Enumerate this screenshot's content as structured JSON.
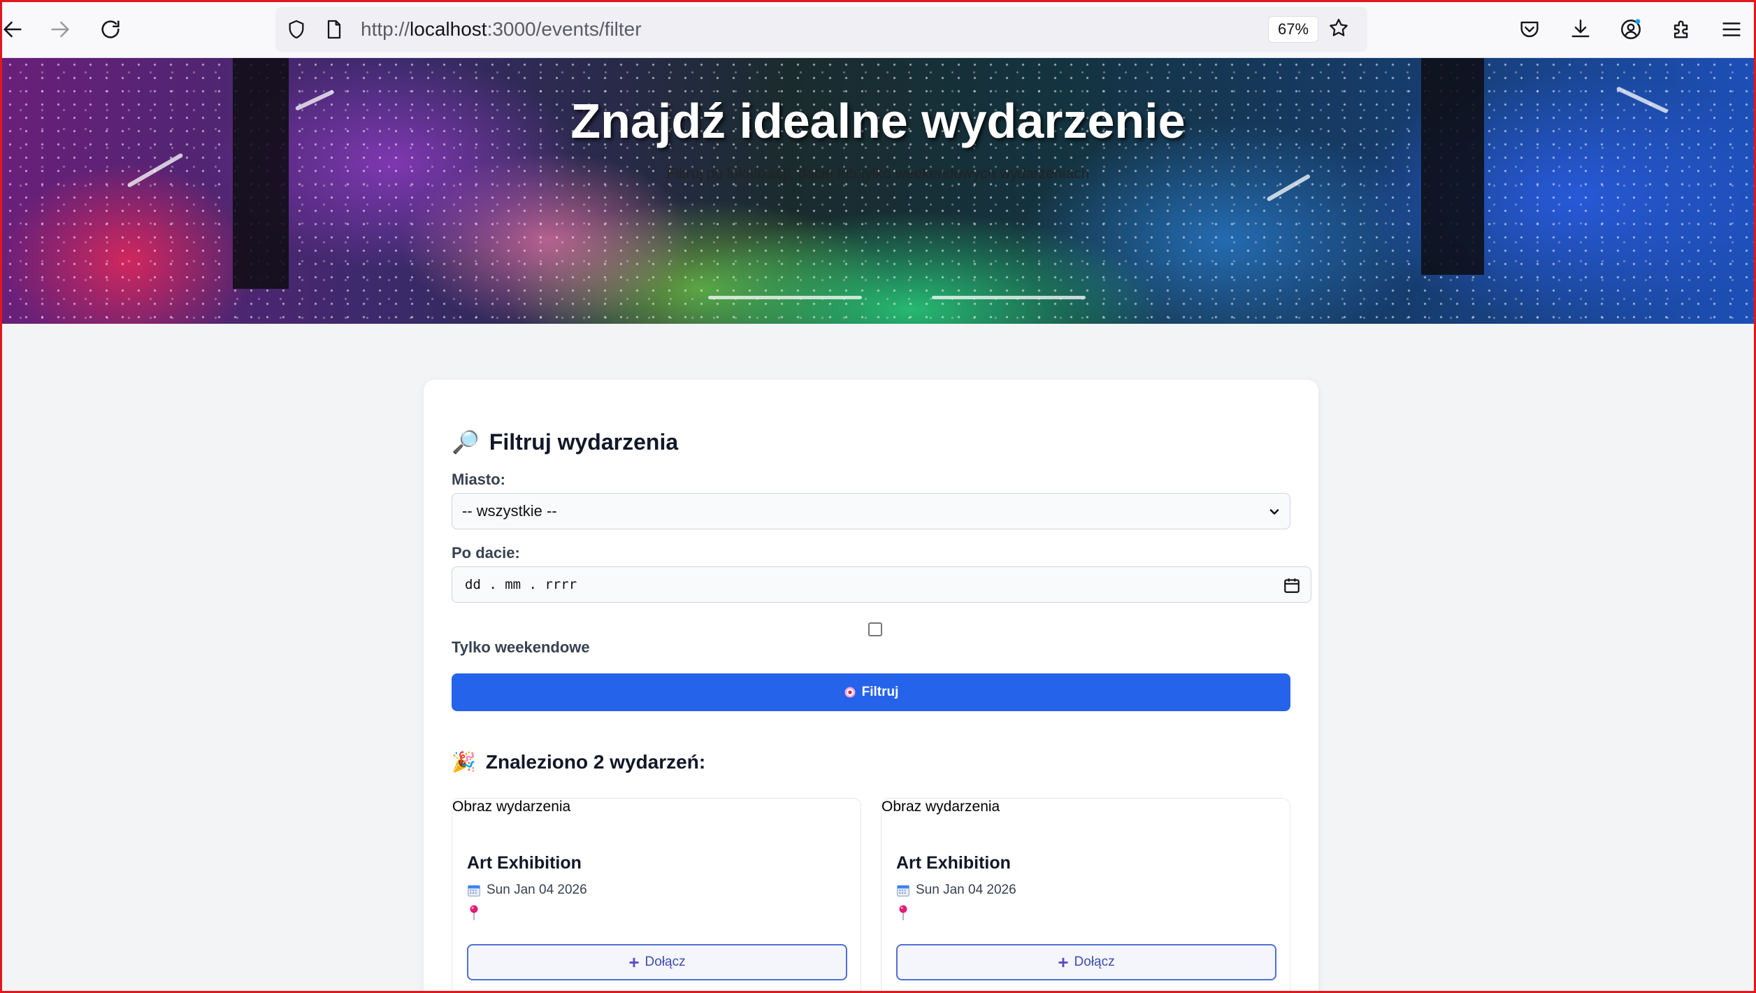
{
  "browser": {
    "url_prefix": "http://",
    "url_host": "localhost",
    "url_rest": ":3000/events/filter",
    "zoom": "67%"
  },
  "hero": {
    "title": "Znajdź idealne wydarzenie",
    "subtitle": "Filtruj po lokalizacji, dacie lub tylko weekendowych wydarzeniach"
  },
  "filter": {
    "emoji": "🔎",
    "heading": "Filtruj wydarzenia",
    "city_label": "Miasto:",
    "city_value": "-- wszystkie --",
    "date_label": "Po dacie:",
    "date_placeholder": "dd . mm . rrrr",
    "weekend_label": "Tylko weekendowe",
    "weekend_checked": false,
    "button_label": "Filtruj"
  },
  "results": {
    "emoji": "🎉",
    "heading": "Znaleziono 2 wydarzeń:",
    "events": [
      {
        "image_alt": "Obraz wydarzenia",
        "title": "Art Exhibition",
        "date": "Sun Jan 04 2026",
        "location": "",
        "join_label": "Dołącz"
      },
      {
        "image_alt": "Obraz wydarzenia",
        "title": "Art Exhibition",
        "date": "Sun Jan 04 2026",
        "location": "",
        "join_label": "Dołącz"
      }
    ]
  },
  "colors": {
    "primary": "#2563eb",
    "join_border": "#4f6fd6",
    "page_bg": "#f3f4f6",
    "frame": "#e3161b"
  }
}
